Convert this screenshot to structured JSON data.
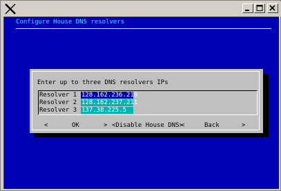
{
  "window": {
    "icon": "x-logo-icon",
    "controls": [
      "minimize-icon",
      "maximize-icon",
      "close-icon"
    ]
  },
  "terminal": {
    "title": "Configure House DNS resolvers",
    "background_color": "#0000b4",
    "title_color": "#00ffff"
  },
  "dialog": {
    "prompt": "Enter up to three DNS resolvers IPs",
    "fields": [
      {
        "label": "Resolver 1",
        "value": "128.162.236.210",
        "focused": true
      },
      {
        "label": "Resolver 2",
        "value": "128.162.237.211",
        "focused": false
      },
      {
        "label": "Resolver 3",
        "value": "137.38.225.5",
        "focused": false
      }
    ],
    "buttons": {
      "ok_left": "<",
      "ok_label": "OK",
      "ok_right": ">",
      "disable_label": "<Disable House DNS>",
      "back_left": "<",
      "back_label": "Back",
      "back_right": ">"
    }
  }
}
